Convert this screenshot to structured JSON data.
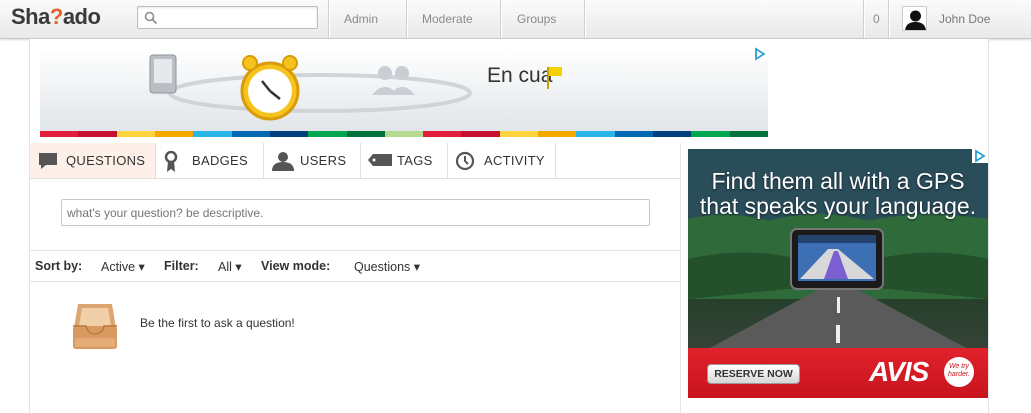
{
  "app": {
    "logo_prefix": "Sha",
    "logo_mark": "?",
    "logo_suffix": "ado"
  },
  "topbar": {
    "search_placeholder": "",
    "nav": [
      {
        "label": "Admin"
      },
      {
        "label": "Moderate"
      },
      {
        "label": "Groups"
      }
    ],
    "notification_count": "0",
    "user_name": "John Doe"
  },
  "banner_ad": {
    "text": "En cua",
    "stripe_colors": [
      "#e31e3b",
      "#c4122f",
      "#ffd33d",
      "#f5a800",
      "#27b6e6",
      "#0067b3",
      "#003e7e",
      "#00a650",
      "#00703c",
      "#b5d98d",
      "#e31e3b",
      "#c4122f",
      "#ffd33d",
      "#f5a800",
      "#27b6e6",
      "#0067b3",
      "#003e7e",
      "#00a650",
      "#00703c"
    ]
  },
  "tabs": [
    {
      "label": "QUESTIONS",
      "icon": "speech-bubble-icon",
      "active": true
    },
    {
      "label": "BADGES",
      "icon": "ribbon-icon",
      "active": false
    },
    {
      "label": "USERS",
      "icon": "user-icon",
      "active": false
    },
    {
      "label": "TAGS",
      "icon": "tag-icon",
      "active": false
    },
    {
      "label": "ACTIVITY",
      "icon": "clock-icon",
      "active": false
    }
  ],
  "ask": {
    "placeholder": "what's your question? be descriptive."
  },
  "sort_bar": {
    "sort_label": "Sort by:",
    "sort_value": "Active ▾",
    "filter_label": "Filter:",
    "filter_value": "All ▾",
    "view_label": "View mode:",
    "view_value": "Questions ▾"
  },
  "empty_state": {
    "message": "Be the first to ask a question!"
  },
  "side_ad": {
    "headline_line1": "Find them all with a GPS",
    "headline_line2": "that speaks your language.",
    "cta": "RESERVE NOW",
    "brand": "AVIS",
    "seal": "We try harder."
  },
  "colors": {
    "active_tab_bg": "#fdf0e8",
    "logo_accent": "#e8612c",
    "avis_red": "#d61a23"
  }
}
